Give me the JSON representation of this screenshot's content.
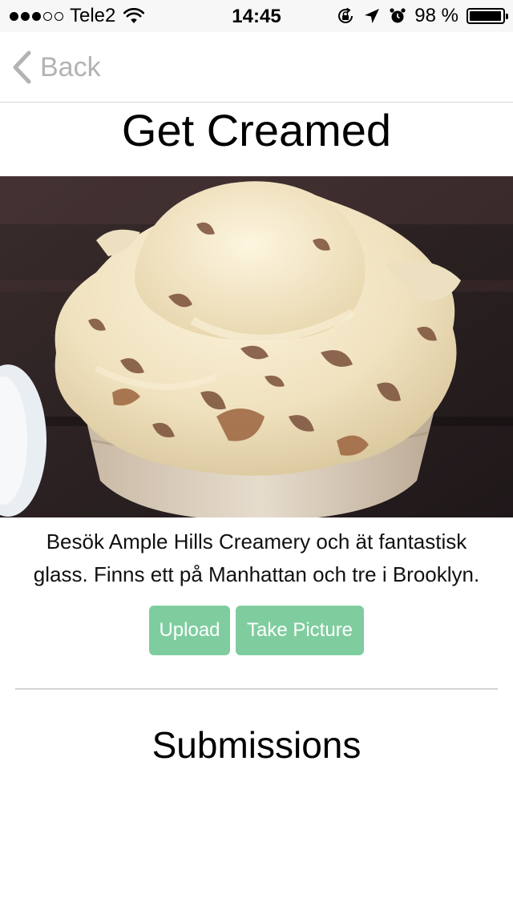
{
  "status_bar": {
    "carrier": "Tele2",
    "time": "14:45",
    "battery_text": "98 %",
    "battery_level": 0.98,
    "signal_bars_filled": 3,
    "signal_bars_total": 5,
    "icons": [
      "wifi-icon",
      "orientation-lock-icon",
      "location-arrow-icon",
      "alarm-clock-icon",
      "battery-icon"
    ]
  },
  "nav": {
    "back_label": "Back",
    "back_icon": "chevron-left-icon"
  },
  "page": {
    "title": "Get Creamed",
    "description_line1": "Besök Ample Hills Creamery och ät fantastisk",
    "description_line2": "glass. Finns ett på Manhattan och tre i Brooklyn.",
    "upload_label": "Upload",
    "take_picture_label": "Take Picture",
    "submissions_title": "Submissions"
  },
  "colors": {
    "button_green": "#7fcd9f",
    "back_gray": "#b3b3b3",
    "status_bar_bg": "#f7f7f7"
  }
}
